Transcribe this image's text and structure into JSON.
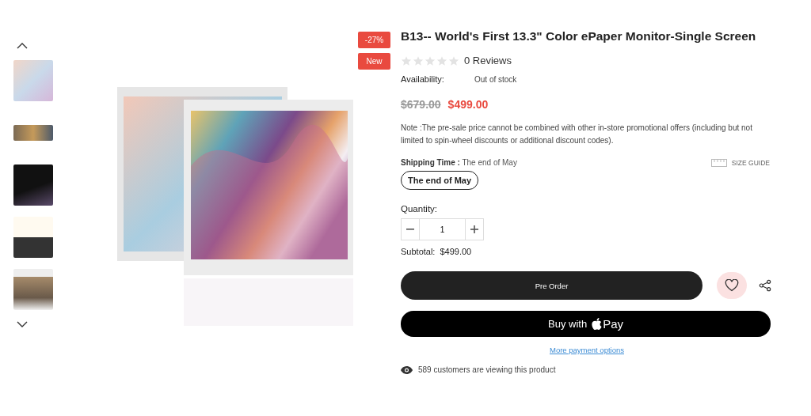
{
  "badges": [
    "-27%",
    "New"
  ],
  "product": {
    "title": "B13-- World's First 13.3\" Color ePaper Monitor-Single Screen",
    "stars": 0,
    "reviews": "0 Reviews",
    "availability_label": "Availability:",
    "availability": "Out of stock",
    "old_price": "$679.00",
    "price": "$499.00",
    "note": "Note :The pre-sale price cannot be combined with other in-store promotional offers (including but not limited to spin-wheel discounts or additional discount codes).",
    "shipping_label": "Shipping Time :",
    "shipping_value": "The end of May",
    "size_guide": "SIZE GUIDE",
    "shipping_options": [
      {
        "label": "The end of May",
        "selected": true
      }
    ],
    "quantity_label": "Quantity:",
    "quantity": "1",
    "subtotal_label": "Subtotal:",
    "subtotal": "$499.00",
    "pre_order": "Pre Order",
    "buy_with": "Buy with",
    "pay": "Pay",
    "more_payment": "More payment options",
    "viewers": "589 customers are viewing this product"
  }
}
